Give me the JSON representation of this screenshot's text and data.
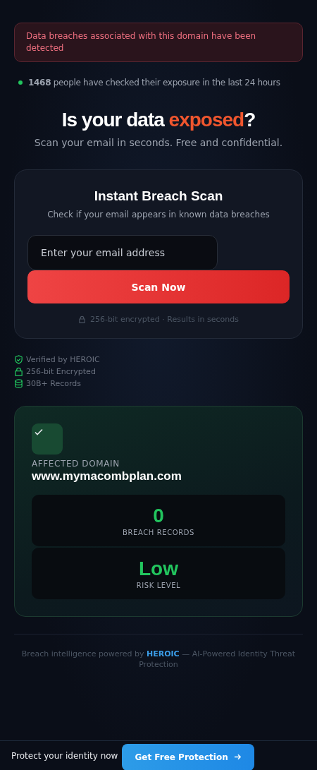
{
  "alert": {
    "text": "Data breaches associated with this domain have been detected"
  },
  "live_stat": {
    "text": "**1468** people have checked their exposure in the last 24 hours"
  },
  "headline": {
    "before": "Is your data ",
    "highlight": "exposed",
    "after": "?"
  },
  "subtitle": "Scan your email in seconds. Free and confidential.",
  "scan_card": {
    "title": "Instant Breach Scan",
    "subtitle": "Check if your email appears in known data breaches",
    "email_field": {
      "placeholder": "Enter your email address"
    },
    "button": "Scan Now",
    "note": "256-bit encrypted · Results in seconds"
  },
  "trust_badges": [
    {
      "kind": "shield",
      "label": "Verified by HEROIC"
    },
    {
      "kind": "lock",
      "label": "256-bit Encrypted"
    },
    {
      "kind": "database",
      "label": "30B+ Records"
    }
  ],
  "result": {
    "label": "AFFECTED DOMAIN",
    "domain": "www.mymacombplan.com",
    "stats": [
      {
        "value": "0",
        "label": "BREACH RECORDS"
      },
      {
        "value": "Low",
        "label": "RISK LEVEL"
      }
    ]
  },
  "footer": {
    "before": "Breach intelligence powered by ",
    "link": "HEROIC",
    "after": " — AI-Powered Identity Threat Protection"
  },
  "bottom_bar": {
    "text": "Protect your identity now",
    "button": "Get Free Protection"
  }
}
